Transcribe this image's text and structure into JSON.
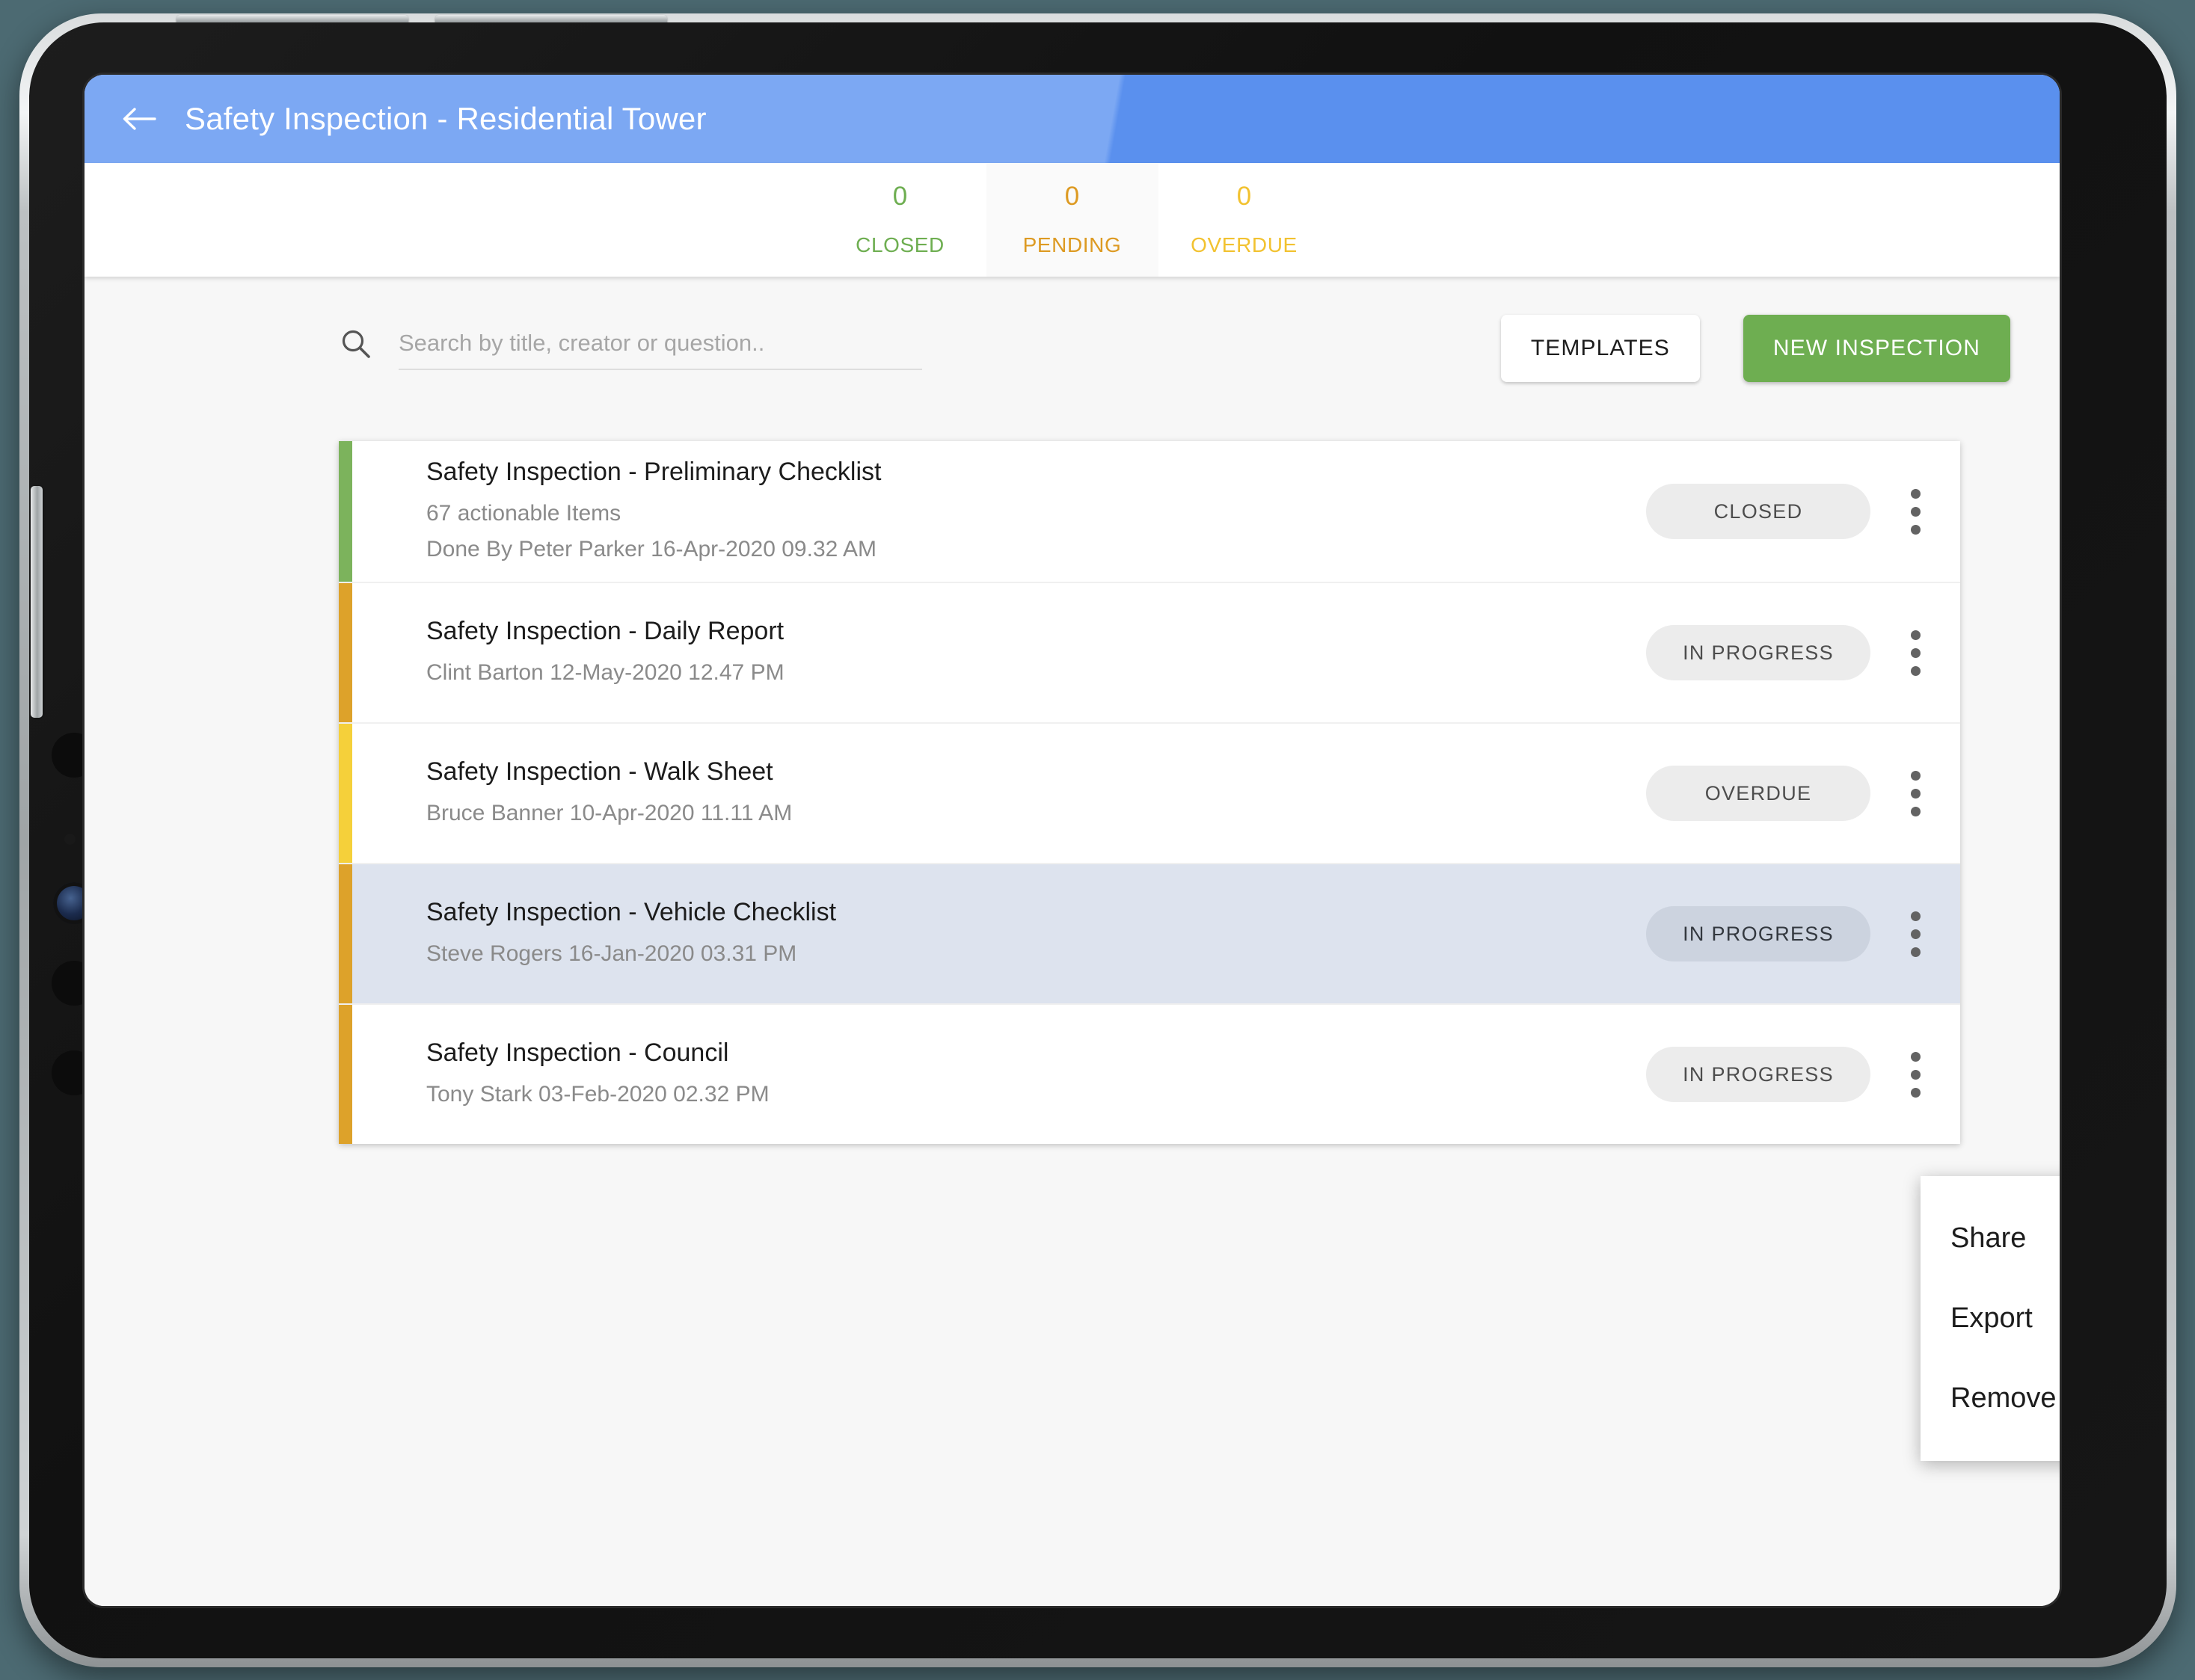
{
  "app": {
    "title": "Safety Inspection - Residential Tower",
    "back_icon": "back-arrow-icon"
  },
  "stats": [
    {
      "value": "0",
      "label": "CLOSED",
      "color": "#6eae51",
      "highlighted": false
    },
    {
      "value": "0",
      "label": "PENDING",
      "color": "#dd9a22",
      "highlighted": true
    },
    {
      "value": "0",
      "label": "OVERDUE",
      "color": "#f2c230",
      "highlighted": false
    }
  ],
  "toolbar": {
    "search_placeholder": "Search by title, creator or question..",
    "search_value": "",
    "search_icon": "search-icon",
    "templates_label": "TEMPLATES",
    "new_inspection_label": "NEW INSPECTION",
    "new_inspection_color": "#6eae51"
  },
  "inspections": [
    {
      "title": "Safety Inspection - Preliminary Checklist",
      "items": "67 actionable Items",
      "meta": "Done By Peter Parker 16-Apr-2020 09.32 AM",
      "status": "CLOSED",
      "bar_color": "#7cb35c",
      "selected": false
    },
    {
      "title": "Safety Inspection - Daily Report",
      "items": "",
      "meta": "Clint Barton 12-May-2020 12.47 PM",
      "status": "IN PROGRESS",
      "bar_color": "#dda22a",
      "selected": false
    },
    {
      "title": "Safety Inspection - Walk Sheet",
      "items": "",
      "meta": "Bruce Banner 10-Apr-2020 11.11 AM",
      "status": "OVERDUE",
      "bar_color": "#f5d03a",
      "selected": false
    },
    {
      "title": "Safety Inspection - Vehicle Checklist",
      "items": "",
      "meta": "Steve Rogers 16-Jan-2020 03.31 PM",
      "status": "IN PROGRESS",
      "bar_color": "#dda22a",
      "selected": true
    },
    {
      "title": "Safety Inspection - Council",
      "items": "",
      "meta": "Tony Stark 03-Feb-2020 02.32 PM",
      "status": "IN PROGRESS",
      "bar_color": "#dda22a",
      "selected": false
    }
  ],
  "context_menu": {
    "items": [
      "Share",
      "Export",
      "Remove"
    ]
  }
}
